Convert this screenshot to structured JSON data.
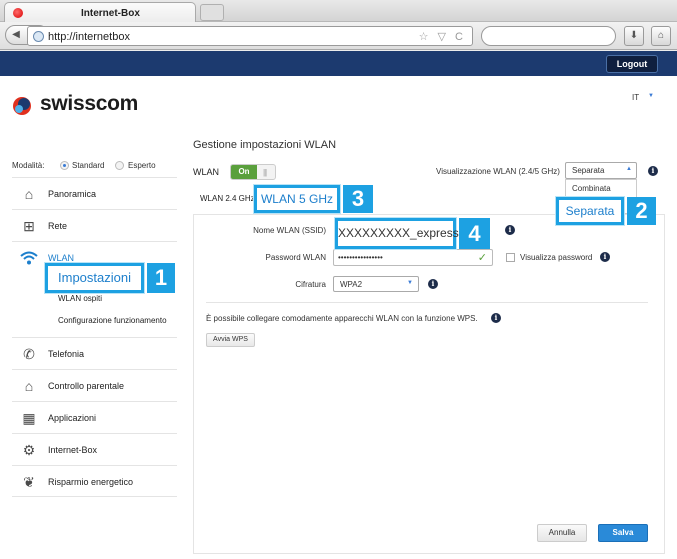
{
  "browser": {
    "tab_title": "Internet-Box",
    "url": "http://internetbox"
  },
  "header": {
    "logout_label": "Logout",
    "brand": "swisscom",
    "language": "IT"
  },
  "sidebar": {
    "mode_label": "Modalità:",
    "mode_standard": "Standard",
    "mode_expert": "Esperto",
    "items": [
      {
        "label": "Panoramica",
        "icon": "home-icon"
      },
      {
        "label": "Rete",
        "icon": "network-icon"
      },
      {
        "label": "WLAN",
        "icon": "wifi-icon"
      },
      {
        "label": "Telefonia",
        "icon": "phone-icon"
      },
      {
        "label": "Controllo parentale",
        "icon": "parental-control-icon"
      },
      {
        "label": "Applicazioni",
        "icon": "apps-icon"
      },
      {
        "label": "Internet-Box",
        "icon": "gear-icon"
      },
      {
        "label": "Risparmio energetico",
        "icon": "leaf-icon"
      }
    ],
    "subitems": [
      "Impostazioni",
      "WLAN ospiti",
      "Configurazione funzionamento"
    ]
  },
  "content": {
    "title": "Gestione impostazioni WLAN",
    "wlan_label": "WLAN",
    "toggle_on": "On",
    "visibility_label": "Visualizzazione WLAN (2.4/5 GHz)",
    "visibility_value": "Separata",
    "visibility_options": [
      "Combinata",
      "Separata"
    ],
    "tab_24": "WLAN 2.4 GHz",
    "tab_5": "WLAN 5 GHz",
    "ssid_label": "Nome WLAN (SSID)",
    "ssid_value": "XXXXXXXXX_express",
    "password_label": "Password WLAN",
    "password_value": "••••••••••••••••",
    "show_password_label": "Visualizza password",
    "cipher_label": "Cifratura",
    "cipher_value": "WPA2",
    "wps_text": "È possibile collegare comodamente apparecchi WLAN con la funzione WPS.",
    "wps_button": "Avvia WPS",
    "cancel_label": "Annulla",
    "save_label": "Salva"
  },
  "callouts": {
    "c1": "1",
    "c2": "2",
    "c3": "3",
    "c4": "4"
  },
  "colors": {
    "brand_navy": "#1c3a6f",
    "accent_blue": "#1d7fcc",
    "callout_blue": "#1da1e2",
    "toggle_green": "#5aa03c"
  }
}
